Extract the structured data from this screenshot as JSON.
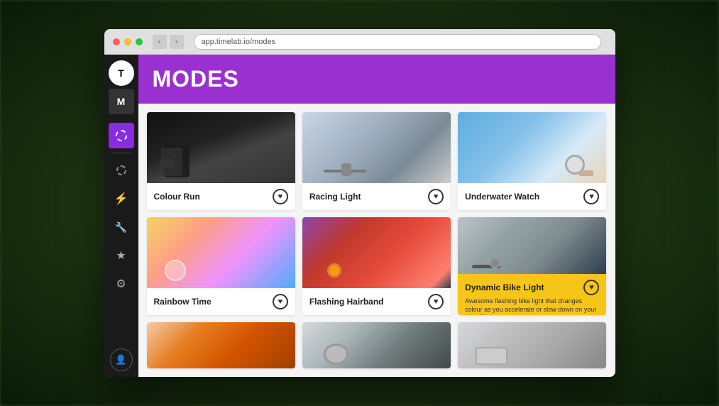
{
  "browser": {
    "address": "app.timelab.io/modes",
    "dots": [
      "red",
      "yellow",
      "green"
    ]
  },
  "sidebar": {
    "logo_t": "T",
    "logo_m": "M",
    "items": [
      {
        "name": "modes-icon",
        "symbol": "☀",
        "active": true
      },
      {
        "name": "circle-dots-icon",
        "symbol": "◌",
        "active": false
      },
      {
        "name": "bolt-icon",
        "symbol": "⚡",
        "active": false
      },
      {
        "name": "wrench-icon",
        "symbol": "🔧",
        "active": false
      },
      {
        "name": "star-icon",
        "symbol": "★",
        "active": false
      },
      {
        "name": "gear-icon",
        "symbol": "⚙",
        "active": false
      }
    ],
    "bottom_icon": {
      "name": "user-icon",
      "symbol": "👤"
    }
  },
  "header": {
    "title": "MODES"
  },
  "modes": [
    {
      "id": "colour-run",
      "name": "Colour Run",
      "img_class": "img-colour-run",
      "has_heart": true
    },
    {
      "id": "racing-light",
      "name": "Racing Light",
      "img_class": "img-racing-light",
      "has_heart": true
    },
    {
      "id": "underwater-watch",
      "name": "Underwater Watch",
      "img_class": "img-underwater-watch",
      "has_heart": true
    },
    {
      "id": "rainbow-time",
      "name": "Rainbow Time",
      "img_class": "img-rainbow-time",
      "has_heart": true
    },
    {
      "id": "flashing-hairband",
      "name": "Flashing Hairband",
      "img_class": "img-flashing-hairband",
      "has_heart": true
    },
    {
      "id": "dynamic-bike-light",
      "name": "Dynamic Bike Light",
      "img_class": "img-dynamic-bike",
      "has_heart": true,
      "featured": true,
      "description": "Awesome flashing bike light that changes colour as you accelerate or slow down on your bike. Play games..."
    },
    {
      "id": "row3-1",
      "name": "",
      "img_class": "img-row3-1",
      "has_heart": false,
      "partial": true
    },
    {
      "id": "row3-2",
      "name": "",
      "img_class": "img-row3-2",
      "has_heart": false,
      "partial": true
    },
    {
      "id": "row3-3",
      "name": "",
      "img_class": "img-row3-3",
      "has_heart": false,
      "partial": true
    }
  ],
  "icons": {
    "heart": "♥"
  }
}
